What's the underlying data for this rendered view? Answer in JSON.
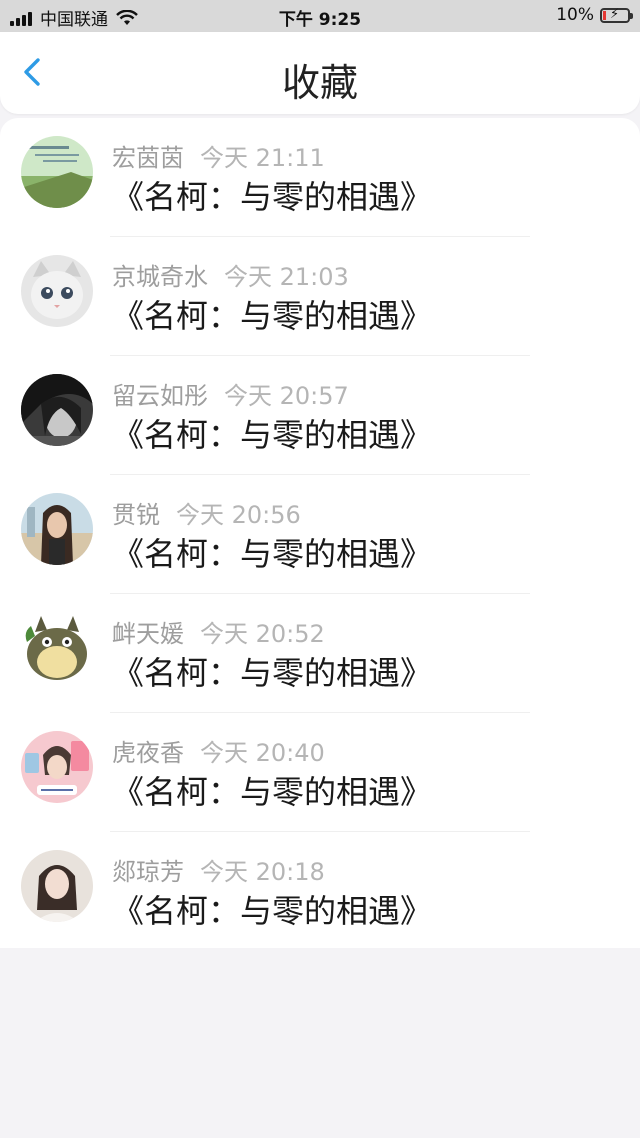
{
  "status_bar": {
    "carrier": "中国联通",
    "time": "下午 9:25",
    "battery": "10%"
  },
  "nav": {
    "title": "收藏",
    "back_icon": "chevron-left-icon",
    "accent": "#2e9be5"
  },
  "items": [
    {
      "user": "宏茵茵",
      "time": "今天 21:11",
      "title": "《名柯：与零的相遇》"
    },
    {
      "user": "京城奇水",
      "time": "今天 21:03",
      "title": "《名柯：与零的相遇》"
    },
    {
      "user": "留云如彤",
      "time": "今天 20:57",
      "title": "《名柯：与零的相遇》"
    },
    {
      "user": "贯锐",
      "time": "今天 20:56",
      "title": "《名柯：与零的相遇》"
    },
    {
      "user": "衅天媛",
      "time": "今天 20:52",
      "title": "《名柯：与零的相遇》"
    },
    {
      "user": "虎夜香",
      "time": "今天 20:40",
      "title": "《名柯：与零的相遇》"
    },
    {
      "user": "郯琼芳",
      "time": "今天 20:18",
      "title": "《名柯：与零的相遇》"
    }
  ]
}
